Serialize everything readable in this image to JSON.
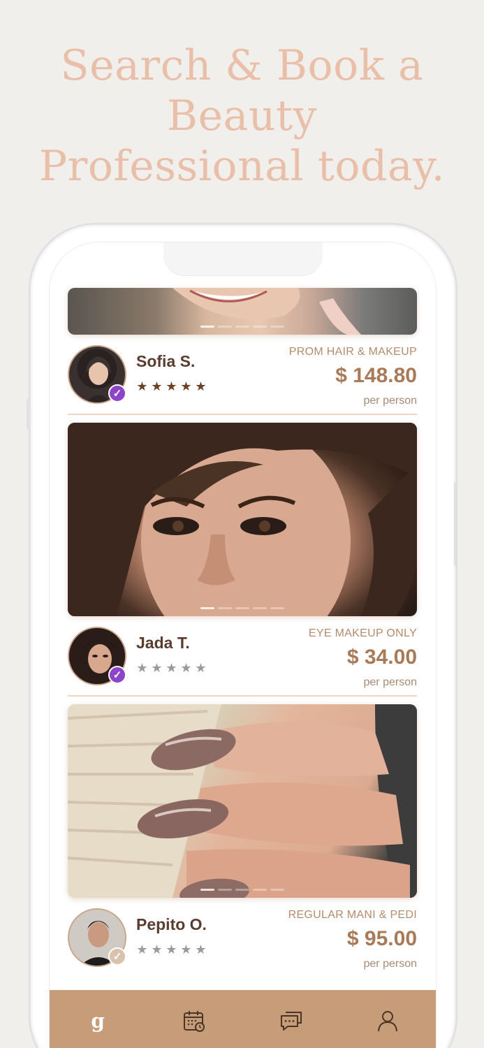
{
  "headline": {
    "line1": "Search & Book a",
    "line2": "Beauty",
    "line3": "Professional today."
  },
  "listings": [
    {
      "name": "Sofia S.",
      "service": "PROM HAIR & MAKEUP",
      "price": "$ 148.80",
      "per": "per person",
      "rating": 5,
      "verified": true,
      "badge_color": "#8e44c9"
    },
    {
      "name": "Jada T.",
      "service": "EYE MAKEUP ONLY",
      "price": "$ 34.00",
      "per": "per person",
      "rating": 0,
      "verified": true,
      "badge_color": "#8e44c9"
    },
    {
      "name": "Pepito O.",
      "service": "REGULAR MANI & PEDI",
      "price": "$ 95.00",
      "per": "per person",
      "rating": 0,
      "verified": true,
      "badge_color": "#d8c2ae"
    }
  ],
  "tabbar": {
    "items": [
      "brand-home-icon",
      "calendar-icon",
      "messages-icon",
      "profile-icon"
    ],
    "brand_glyph": "g"
  },
  "colors": {
    "accent": "#c79c78",
    "headline": "#eabfaa",
    "star_filled": "#6b4226",
    "star_empty": "#9a9a9a"
  }
}
